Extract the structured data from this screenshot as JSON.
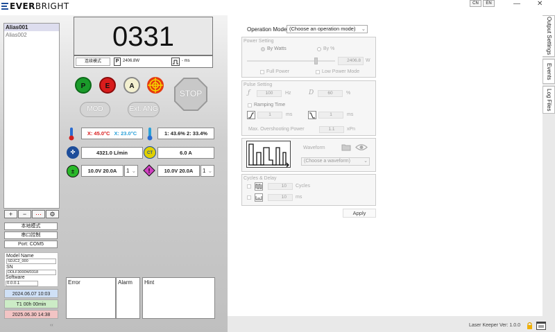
{
  "app": {
    "logo": {
      "prefix": "EVER",
      "suffix": "BRIGHT"
    },
    "lang": [
      "CN",
      "EN"
    ],
    "window_buttons": [
      "—",
      "✕"
    ]
  },
  "sidebar": {
    "items": [
      "Alias001",
      "Alias002"
    ],
    "tool_buttons": [
      "+",
      "−",
      "⋯",
      "⚙"
    ],
    "local_mode": "本地模式",
    "serial_control": "串口控制",
    "port": "Port: COM5",
    "model_label": "Model Name",
    "model_value": "SDJC2_000",
    "sn_label": "SN",
    "sn_value": "DDLF3000W0318",
    "software_label": "Software",
    "software_value": "0.0.0.1",
    "date1": "2024.06.07  10:03",
    "timer": "T1  00h  00min",
    "date2": "2025.06.30  14:38",
    "collapse": "‹‹"
  },
  "display": {
    "code": "0331",
    "mode_label": "连续模式",
    "power_tag": "P",
    "power_value": "2406.8W",
    "time_value": "- ms"
  },
  "buttons": {
    "p": "P",
    "e": "E",
    "a": "A",
    "stop": "STOP",
    "mod": "MOD",
    "ext_ang": "Ext. ANG"
  },
  "status": {
    "temp_x1": "X: 45.0°C",
    "temp_x2": "X: 23.0°C",
    "humidity": "1: 43.6%  2: 33.4%",
    "flow": "4321.0 L/min",
    "current": "6.0 A",
    "ps1": "10.0V 20.0A",
    "ps1_sel": "1",
    "ps2": "10.0V 20.0A",
    "ps2_sel": "1"
  },
  "bottom": {
    "error": "Error",
    "alarm": "Alarm",
    "hint": "Hint"
  },
  "settings": {
    "operation_mode_label": "Operation Mode",
    "operation_mode_value": "(Choose an operation mode)",
    "power_setting": "Power Setting",
    "by_watts": "By Watts",
    "by_percent": "By %",
    "power_value": "2406.8",
    "power_unit": "W",
    "full_power": "Full Power",
    "low_power_mode": "Low Power Mode",
    "pulse_setting": "Pulse Setting",
    "freq_value": "100",
    "freq_unit": "Hz",
    "duty_value": "60",
    "duty_unit": "%",
    "ramping_time": "Ramping Time",
    "ramp_up_value": "1",
    "ramp_down_value": "1",
    "ms": "ms",
    "max_overshoot": "Max. Overshooting Power",
    "overshoot_value": "1.1",
    "overshoot_unit": "xPn",
    "waveform_label": "Waveform",
    "waveform_value": "(Choose a waveform)",
    "cycles_delay": "Cycles & Delay",
    "cycles_value": "10",
    "cycles_unit": "Cycles",
    "delay_value": "10",
    "delay_unit": "ms",
    "apply": "Apply"
  },
  "tabs": [
    "Output Settings",
    "Events",
    "Log Files"
  ],
  "footer": {
    "app_name": "Laser Keeper",
    "version": "Ver: 1.0.0"
  },
  "colors": {
    "green": "#1a9b2a",
    "red": "#d81c1c",
    "cream": "#f3f0d0",
    "orange": "#e53a10",
    "blue": "#1d4d9a",
    "cyan": "#2aa0d8",
    "yellow": "#e0d000",
    "magenta": "#d040c0"
  }
}
